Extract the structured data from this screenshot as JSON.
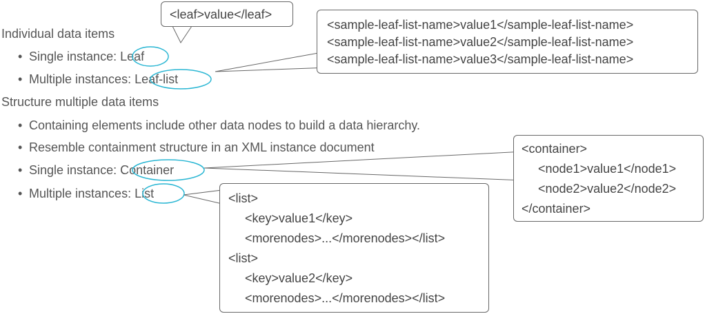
{
  "sections": {
    "individual": {
      "heading": "Individual data items",
      "bullets": [
        {
          "text": "Single instance: ",
          "highlight": "Leaf"
        },
        {
          "text": "Multiple instances: ",
          "highlight": "Leaf-list"
        }
      ]
    },
    "structure": {
      "heading": "Structure multiple data items",
      "bullets": [
        {
          "text": "Containing elements include other data nodes to build a data hierarchy."
        },
        {
          "text": "Resemble containment structure in an XML instance document"
        },
        {
          "text": "Single instance: ",
          "highlight": "Container"
        },
        {
          "text": "Multiple instances: ",
          "highlight": "List"
        }
      ]
    }
  },
  "bullet_symbol": "•",
  "callouts": {
    "leaf": {
      "lines": [
        "<leaf>value</leaf>"
      ]
    },
    "leaf_list": {
      "lines": [
        "<sample-leaf-list-name>value1</sample-leaf-list-name>",
        "<sample-leaf-list-name>value2</sample-leaf-list-name>",
        "<sample-leaf-list-name>value3</sample-leaf-list-name>"
      ]
    },
    "container": {
      "lines": [
        "<container>",
        "<node1>value1</node1>",
        "<node2>value2</node2>",
        "</container>"
      ]
    },
    "list": {
      "lines": [
        "<list>",
        "<key>value1</key>",
        "<morenodes>...</morenodes></list>",
        "<list>",
        "<key>value2</key>",
        "<morenodes>...</morenodes></list>"
      ]
    }
  },
  "colors": {
    "text": "#555555",
    "highlight_ellipse": "#29B6D3",
    "callout_border": "#666666"
  }
}
